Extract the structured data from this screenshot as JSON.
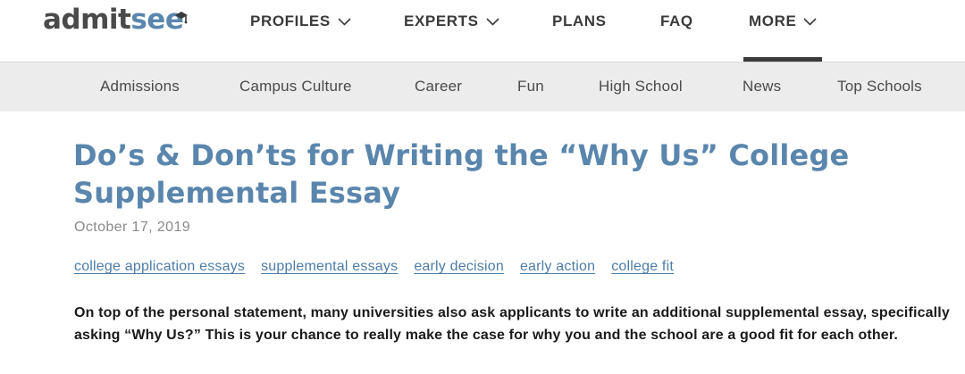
{
  "header": {
    "logo": {
      "part1": "admit",
      "part2": "see"
    },
    "nav": [
      {
        "label": "PROFILES",
        "has_dropdown": true
      },
      {
        "label": "EXPERTS",
        "has_dropdown": true
      },
      {
        "label": "PLANS",
        "has_dropdown": false
      },
      {
        "label": "FAQ",
        "has_dropdown": false
      },
      {
        "label": "MORE",
        "has_dropdown": true,
        "active": true
      }
    ]
  },
  "subnav": {
    "items": [
      "Admissions",
      "Campus Culture",
      "Career",
      "Fun",
      "High School",
      "News",
      "Top Schools"
    ]
  },
  "article": {
    "title": "Do’s & Don’ts for Writing the “Why Us” College Supplemental Essay",
    "date": "October 17, 2019",
    "tags": [
      "college application essays",
      "supplemental essays",
      "early decision",
      "early action",
      "college fit"
    ],
    "lead": "On top of the personal statement, many universities also ask applicants to write an additional supplemental essay, specifically asking “Why Us?” This is your chance to really make the case for why you and the school are a good fit for each other."
  },
  "colors": {
    "brand_blue": "#5a86ad",
    "link_blue": "#4d7ca6",
    "nav_text": "#3a3a3a",
    "subnav_bg": "#ececec",
    "date_gray": "#8a8a8a"
  },
  "icons": [
    "chevron-down-icon",
    "logo-hat-icon"
  ]
}
